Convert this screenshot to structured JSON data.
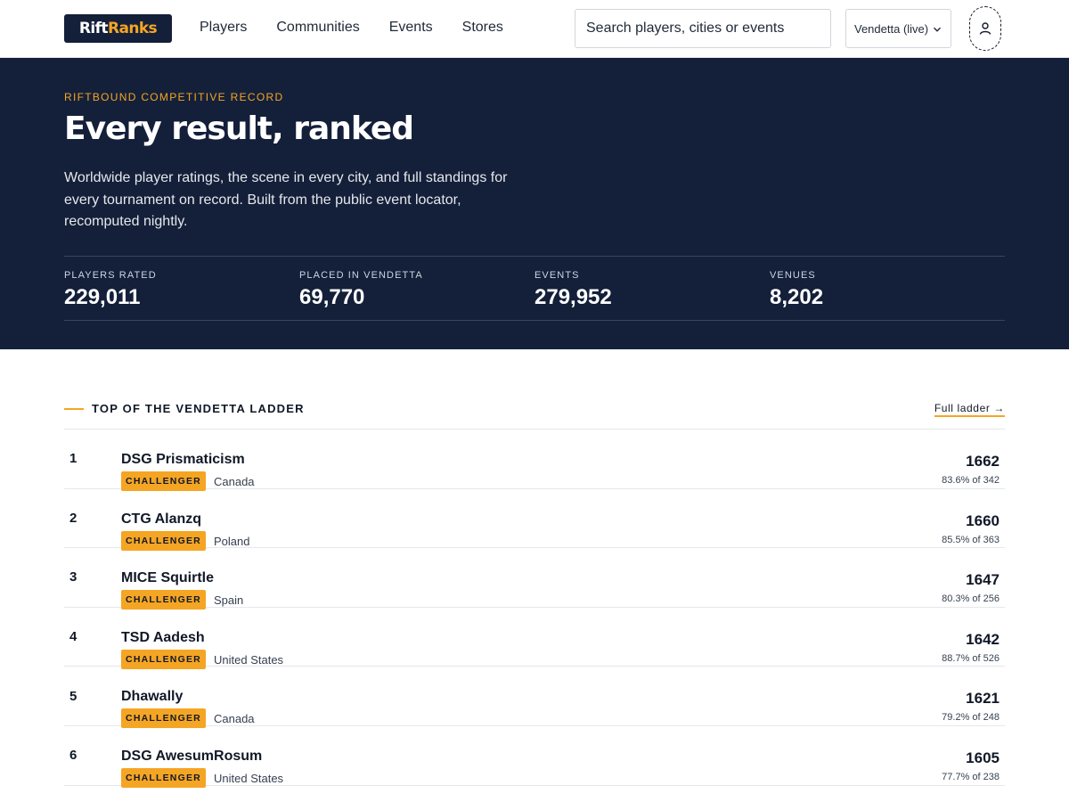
{
  "header": {
    "logo": {
      "part1": "Rift",
      "part2": "Ranks"
    },
    "nav": [
      "Players",
      "Communities",
      "Events",
      "Stores"
    ],
    "search_placeholder": "Search players, cities or events",
    "set_selector": "Vendetta (live)"
  },
  "hero": {
    "eyebrow": "RIFTBOUND COMPETITIVE RECORD",
    "title": "Every result, ranked",
    "description": "Worldwide player ratings, the scene in every city, and full standings for every tournament on record. Built from the public event locator, recomputed nightly.",
    "stats": [
      {
        "label": "PLAYERS RATED",
        "value": "229,011"
      },
      {
        "label": "PLACED IN VENDETTA",
        "value": "69,770"
      },
      {
        "label": "EVENTS",
        "value": "279,952"
      },
      {
        "label": "VENUES",
        "value": "8,202"
      }
    ]
  },
  "ladder": {
    "title": "TOP OF THE VENDETTA LADDER",
    "full_link": "Full ladder →",
    "rows": [
      {
        "rank": "1",
        "name": "DSG Prismaticism",
        "tier": "CHALLENGER",
        "country": "Canada",
        "rating": "1662",
        "record": "83.6% of 342"
      },
      {
        "rank": "2",
        "name": "CTG Alanzq",
        "tier": "CHALLENGER",
        "country": "Poland",
        "rating": "1660",
        "record": "85.5% of 363"
      },
      {
        "rank": "3",
        "name": "MICE Squirtle",
        "tier": "CHALLENGER",
        "country": "Spain",
        "rating": "1647",
        "record": "80.3% of 256"
      },
      {
        "rank": "4",
        "name": "TSD Aadesh",
        "tier": "CHALLENGER",
        "country": "United States",
        "rating": "1642",
        "record": "88.7% of 526"
      },
      {
        "rank": "5",
        "name": "Dhawally",
        "tier": "CHALLENGER",
        "country": "Canada",
        "rating": "1621",
        "record": "79.2% of 248"
      },
      {
        "rank": "6",
        "name": "DSG AwesumRosum",
        "tier": "CHALLENGER",
        "country": "United States",
        "rating": "1605",
        "record": "77.7% of 238"
      }
    ]
  },
  "colors": {
    "navy": "#14203a",
    "accent": "#f5a524"
  },
  "icons": {
    "select": "chevron-down-icon",
    "account": "user-icon"
  }
}
